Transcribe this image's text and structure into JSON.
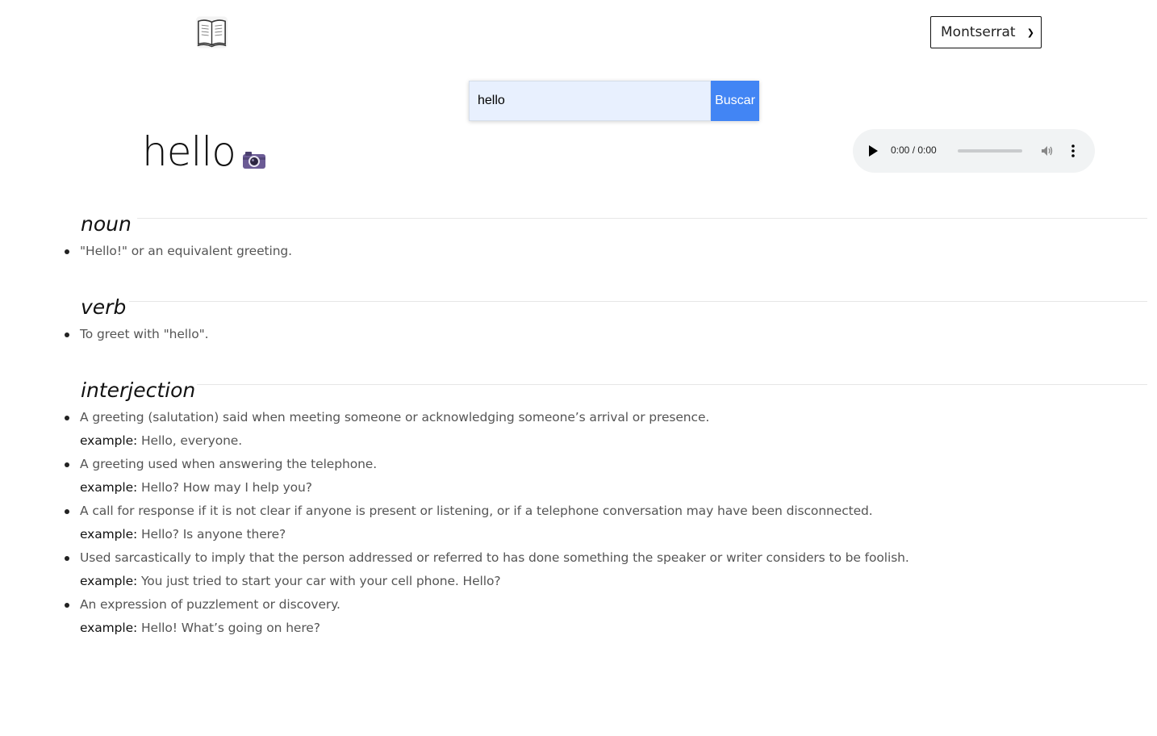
{
  "header": {
    "logo_icon": "open-book-icon",
    "font_select": {
      "value": "Montserrat"
    }
  },
  "search": {
    "value": "hello",
    "button_label": "Buscar"
  },
  "entry": {
    "word": "hello",
    "image_icon": "camera-icon",
    "audio": {
      "time": "0:00 / 0:00"
    }
  },
  "meanings": [
    {
      "part_of_speech": "noun",
      "definitions": [
        {
          "text": "\"Hello!\" or an equivalent greeting."
        }
      ]
    },
    {
      "part_of_speech": "verb",
      "definitions": [
        {
          "text": "To greet with \"hello\"."
        }
      ]
    },
    {
      "part_of_speech": "interjection",
      "definitions": [
        {
          "text": "A greeting (salutation) said when meeting someone or acknowledging someone’s arrival or presence.",
          "example_label": "example:",
          "example": "Hello, everyone."
        },
        {
          "text": "A greeting used when answering the telephone.",
          "example_label": "example:",
          "example": "Hello? How may I help you?"
        },
        {
          "text": "A call for response if it is not clear if anyone is present or listening, or if a telephone conversation may have been disconnected.",
          "example_label": "example:",
          "example": "Hello? Is anyone there?"
        },
        {
          "text": "Used sarcastically to imply that the person addressed or referred to has done something the speaker or writer considers to be foolish.",
          "example_label": "example:",
          "example": "You just tried to start your car with your cell phone. Hello?"
        },
        {
          "text": "An expression of puzzlement or discovery.",
          "example_label": "example:",
          "example": "Hello! What’s going on here?"
        }
      ]
    }
  ]
}
